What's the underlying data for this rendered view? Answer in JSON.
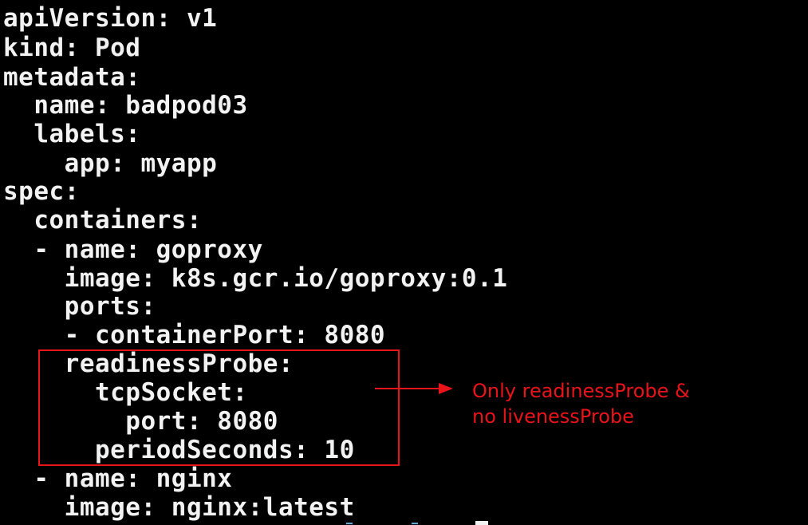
{
  "terminal": {
    "lines": [
      "apiVersion: v1",
      "kind: Pod",
      "metadata:",
      "  name: badpod03",
      "  labels:",
      "    app: myapp",
      "spec:",
      "  containers:",
      "  - name: goproxy",
      "    image: k8s.gcr.io/goproxy:0.1",
      "    ports:",
      "    - containerPort: 8080",
      "    readinessProbe:",
      "      tcpSocket:",
      "        port: 8080",
      "      periodSeconds: 10",
      "  - name: nginx",
      "    image: nginx:latest"
    ]
  },
  "annotation": {
    "line1": "Only readinessProbe &",
    "line2": "no livenessProbe"
  },
  "colors": {
    "background": "#000000",
    "text": "#f2f2f2",
    "highlight": "#e8141a"
  }
}
